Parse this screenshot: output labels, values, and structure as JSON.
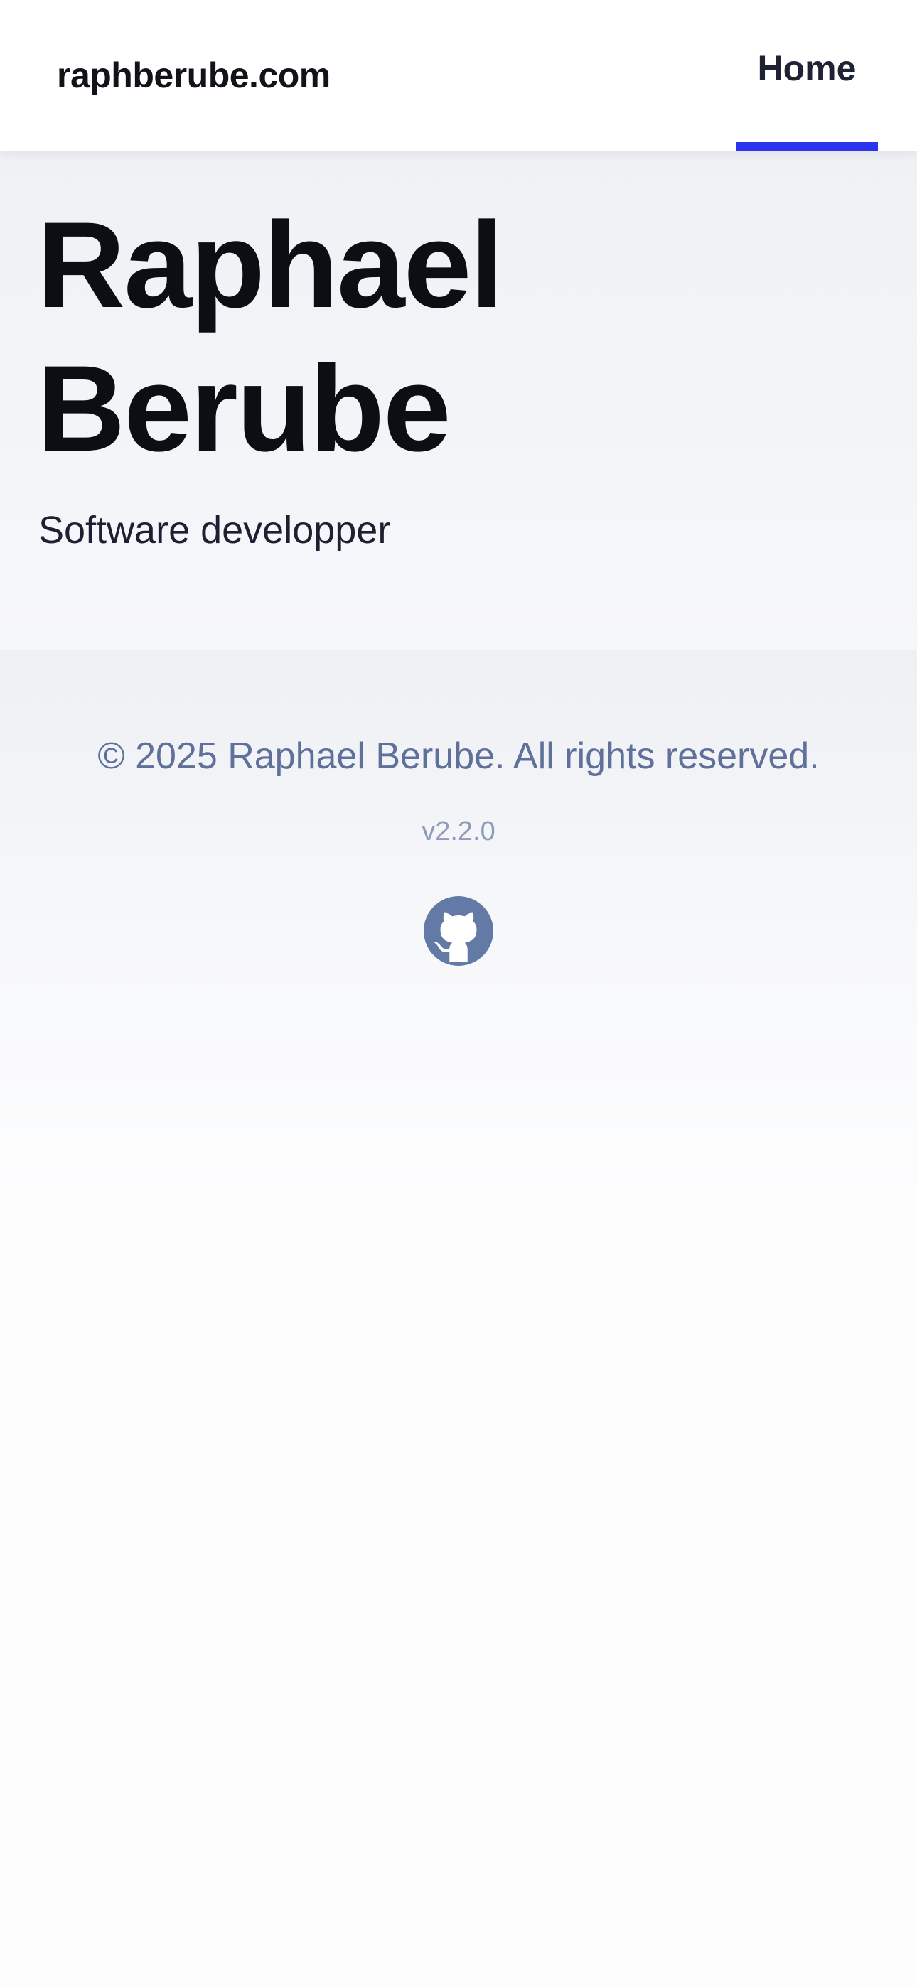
{
  "header": {
    "brand": "raphberube.com",
    "nav": {
      "home_label": "Home"
    }
  },
  "hero": {
    "title": "Raphael Berube",
    "subtitle": "Software developper"
  },
  "footer": {
    "copyright": "© 2025 Raphael Berube. All rights reserved.",
    "version": "v2.2.0",
    "github_icon": "github-icon"
  },
  "colors": {
    "accent": "#2b35f0",
    "footer_text": "#5f709b",
    "version_text": "#8f9bb8",
    "icon": "#647aa6"
  }
}
